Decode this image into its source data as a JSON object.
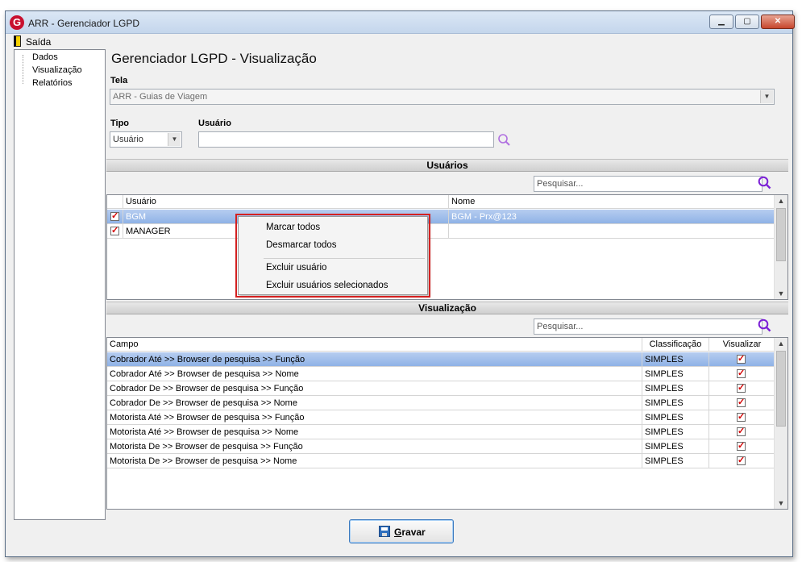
{
  "window": {
    "title": "ARR - Gerenciador LGPD",
    "logo_letter": "G",
    "minimize": "▁",
    "maximize": "▢",
    "close": "✕"
  },
  "menu": {
    "exit_label": "Saída"
  },
  "tree": {
    "items": [
      "Dados",
      "Visualização",
      "Relatórios"
    ]
  },
  "page_title": "Gerenciador LGPD - Visualização",
  "form": {
    "tela_label": "Tela",
    "tela_value": "ARR - Guias de Viagem",
    "tipo_label": "Tipo",
    "tipo_value": "Usuário",
    "usuario_label": "Usuário",
    "usuario_value": ""
  },
  "users_section": {
    "header": "Usuários",
    "search_placeholder": "Pesquisar...",
    "columns": [
      "Usuário",
      "Nome"
    ],
    "rows": [
      {
        "checked": true,
        "usuario": "BGM",
        "nome": "BGM - Prx@123",
        "selected": true
      },
      {
        "checked": true,
        "usuario": "MANAGER",
        "nome": "",
        "selected": false
      }
    ]
  },
  "context_menu": {
    "items": [
      "Marcar todos",
      "Desmarcar todos",
      "Excluir usuário",
      "Excluir usuários selecionados"
    ]
  },
  "view_section": {
    "header": "Visualização",
    "search_placeholder": "Pesquisar...",
    "columns": [
      "Campo",
      "Classificação",
      "Visualizar"
    ],
    "rows": [
      {
        "campo": "Cobrador Até >> Browser de pesquisa >> Função",
        "classificacao": "SIMPLES",
        "visualizar": true,
        "selected": true
      },
      {
        "campo": "Cobrador Até >> Browser de pesquisa >> Nome",
        "classificacao": "SIMPLES",
        "visualizar": true
      },
      {
        "campo": "Cobrador De >> Browser de pesquisa >> Função",
        "classificacao": "SIMPLES",
        "visualizar": true
      },
      {
        "campo": "Cobrador De >> Browser de pesquisa >> Nome",
        "classificacao": "SIMPLES",
        "visualizar": true
      },
      {
        "campo": "Motorista Até >> Browser de pesquisa >> Função",
        "classificacao": "SIMPLES",
        "visualizar": true
      },
      {
        "campo": "Motorista Até >> Browser de pesquisa >> Nome",
        "classificacao": "SIMPLES",
        "visualizar": true
      },
      {
        "campo": "Motorista De >> Browser de pesquisa >> Função",
        "classificacao": "SIMPLES",
        "visualizar": true
      },
      {
        "campo": "Motorista De >> Browser de pesquisa >> Nome",
        "classificacao": "SIMPLES",
        "visualizar": true
      }
    ]
  },
  "footer": {
    "save_label": "Gravar"
  },
  "colors": {
    "accent": "#8a2be2",
    "selected_row": "#8fb2e6",
    "context_outline": "#d42020",
    "check": "#d40000"
  }
}
